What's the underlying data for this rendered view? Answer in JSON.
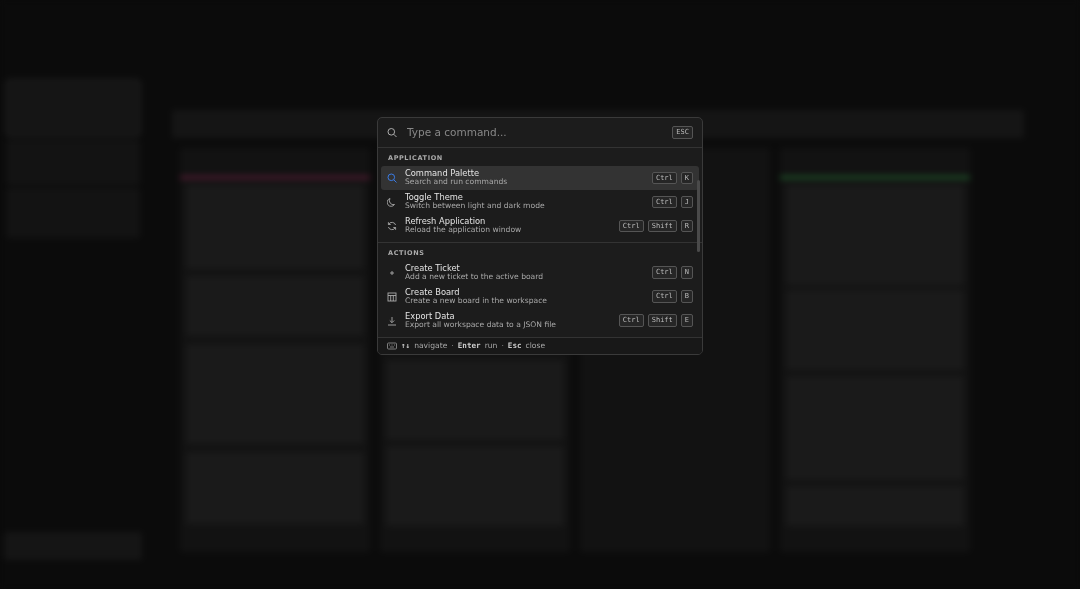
{
  "command_palette": {
    "search": {
      "placeholder": "Type a command..."
    },
    "close_key": "ESC",
    "sections": [
      {
        "title": "APPLICATION",
        "items": [
          {
            "kind": "search",
            "title": "Command Palette",
            "description": "Search and run commands",
            "keys": [
              "Ctrl",
              "K"
            ],
            "selected": true
          },
          {
            "kind": "moon",
            "title": "Toggle Theme",
            "description": "Switch between light and dark mode",
            "keys": [
              "Ctrl",
              "J"
            ],
            "selected": false
          },
          {
            "kind": "refresh",
            "title": "Refresh Application",
            "description": "Reload the application window",
            "keys": [
              "Ctrl",
              "Shift",
              "R"
            ],
            "selected": false
          }
        ]
      },
      {
        "title": "ACTIONS",
        "items": [
          {
            "kind": "plus",
            "title": "Create Ticket",
            "description": "Add a new ticket to the active board",
            "keys": [
              "Ctrl",
              "N"
            ],
            "selected": false
          },
          {
            "kind": "board",
            "title": "Create Board",
            "description": "Create a new board in the workspace",
            "keys": [
              "Ctrl",
              "B"
            ],
            "selected": false
          },
          {
            "kind": "download",
            "title": "Export Data",
            "description": "Export all workspace data to a JSON file",
            "keys": [
              "Ctrl",
              "Shift",
              "E"
            ],
            "selected": false
          }
        ]
      }
    ],
    "footer": {
      "separator": "·",
      "hints": [
        {
          "key": "↑↓",
          "label": "navigate"
        },
        {
          "key": "Enter",
          "label": "run"
        },
        {
          "key": "Esc",
          "label": "close"
        }
      ]
    }
  }
}
